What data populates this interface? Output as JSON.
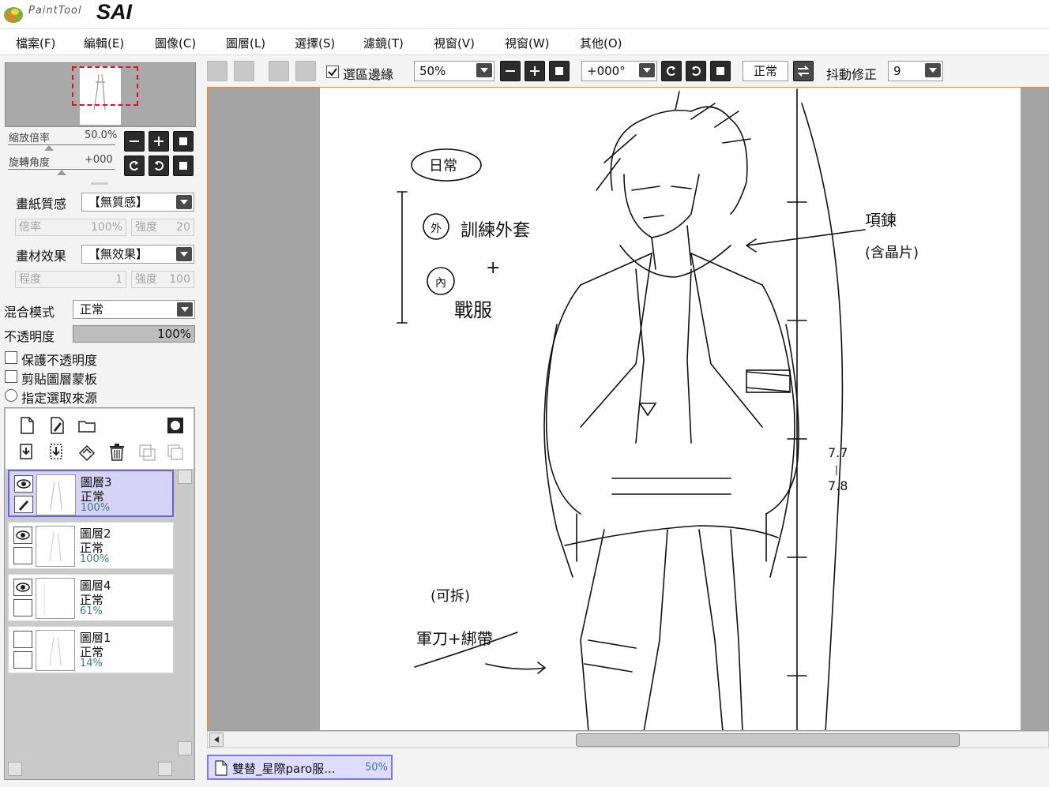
{
  "app": {
    "logo_small": "PaintTool",
    "logo_big": "SAI"
  },
  "menu": [
    {
      "label": "檔案(F)",
      "name": "menu-file"
    },
    {
      "label": "編輯(E)",
      "name": "menu-edit"
    },
    {
      "label": "圖像(C)",
      "name": "menu-image"
    },
    {
      "label": "圖層(L)",
      "name": "menu-layer"
    },
    {
      "label": "選擇(S)",
      "name": "menu-select"
    },
    {
      "label": "濾鏡(T)",
      "name": "menu-filter"
    },
    {
      "label": "視窗(V)",
      "name": "menu-view"
    },
    {
      "label": "視窗(W)",
      "name": "menu-window"
    },
    {
      "label": "其他(O)",
      "name": "menu-others"
    }
  ],
  "navigator": {
    "zoom_label": "縮放倍率",
    "zoom_value": "50.0%",
    "rotate_label": "旋轉角度",
    "rotate_value": "+000"
  },
  "paper_texture": {
    "label": "畫紙質感",
    "value": "【無質感】",
    "rate_label": "倍率",
    "rate_value": "100%",
    "strength_label": "強度",
    "strength_value": "20"
  },
  "brush_effect": {
    "label": "畫材效果",
    "value": "【無效果】",
    "degree_label": "程度",
    "degree_value": "1",
    "strength_label": "強度",
    "strength_value": "100"
  },
  "blend": {
    "label": "混合模式",
    "value": "正常"
  },
  "opacity": {
    "label": "不透明度",
    "value": "100%"
  },
  "options": {
    "protect_opacity": "保護不透明度",
    "clip_mask": "剪貼圖層蒙板",
    "selection_source": "指定選取來源"
  },
  "layers": [
    {
      "name": "圖層3",
      "mode": "正常",
      "opacity": "100%",
      "selected": true,
      "visible": true
    },
    {
      "name": "圖層2",
      "mode": "正常",
      "opacity": "100%",
      "selected": false,
      "visible": true
    },
    {
      "name": "圖層4",
      "mode": "正常",
      "opacity": "61%",
      "selected": false,
      "visible": true
    },
    {
      "name": "圖層1",
      "mode": "正常",
      "opacity": "14%",
      "selected": false,
      "visible": false
    }
  ],
  "toolbar": {
    "selection_edge_label": "選區邊緣",
    "zoom_value": "50%",
    "rotate_value": "+000°",
    "mode_value": "正常",
    "stabilizer_label": "抖動修正",
    "stabilizer_value": "9"
  },
  "canvas_notes": {
    "daily": "日常",
    "outer": "外",
    "training_jacket": "訓練外套",
    "plus": "+",
    "inner": "內",
    "battle_suit": "戰服",
    "necklace": "項鍊",
    "tag": "(含晶片)",
    "detachable": "(可拆)",
    "sword_belt": "軍刀+綁帶",
    "measure1": "7.7",
    "measure_dash": "|",
    "measure2": "7.8"
  },
  "doc_tab": {
    "title": "雙替_星際paro服...",
    "zoom": "50%"
  },
  "colors": {
    "accent": "#6664d8",
    "selection_frame": "#e0102a",
    "canvas_border": "#e08a5a"
  }
}
